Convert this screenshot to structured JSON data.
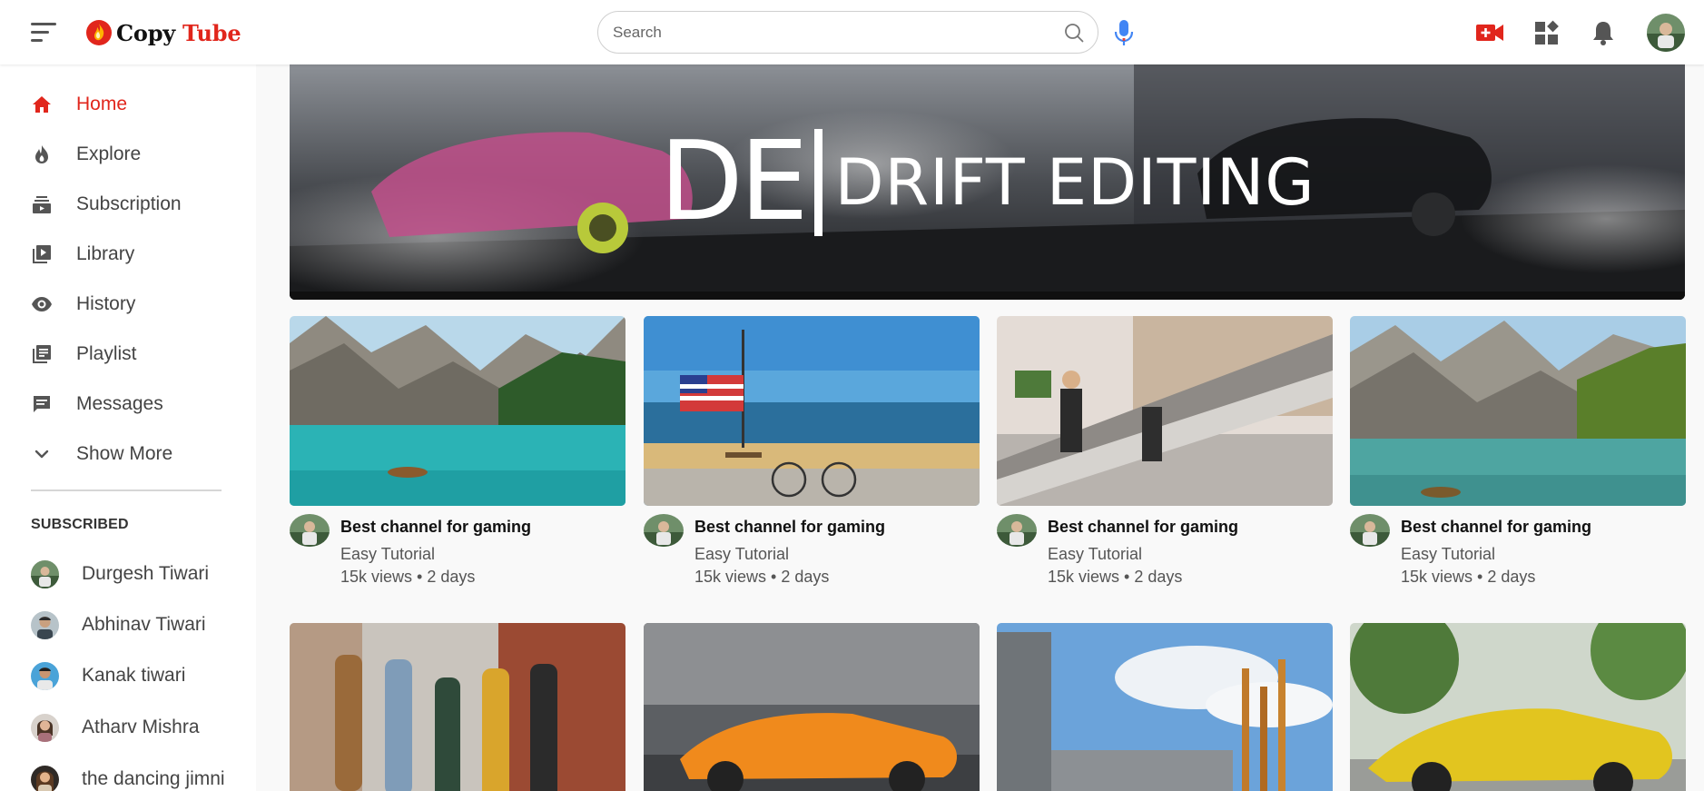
{
  "header": {
    "logo_word1": "Copy",
    "logo_word2": "Tube",
    "search_placeholder": "Search",
    "search_value": ""
  },
  "colors": {
    "accent": "#e1261c",
    "mic": "#4285f4"
  },
  "sidebar": {
    "items": [
      {
        "label": "Home",
        "icon": "home-icon",
        "active": true
      },
      {
        "label": "Explore",
        "icon": "flame-icon",
        "active": false
      },
      {
        "label": "Subscription",
        "icon": "subscriptions-icon",
        "active": false
      },
      {
        "label": "Library",
        "icon": "library-icon",
        "active": false
      },
      {
        "label": "History",
        "icon": "eye-icon",
        "active": false
      },
      {
        "label": "Playlist",
        "icon": "playlist-icon",
        "active": false
      },
      {
        "label": "Messages",
        "icon": "chat-icon",
        "active": false
      },
      {
        "label": "Show More",
        "icon": "chevron-down-icon",
        "active": false
      }
    ],
    "subscribed_heading": "SUBSCRIBED",
    "subscriptions": [
      {
        "name": "Durgesh Tiwari"
      },
      {
        "name": "Abhinav Tiwari"
      },
      {
        "name": "Kanak tiwari"
      },
      {
        "name": "Atharv Mishra"
      },
      {
        "name": "the dancing jimni"
      }
    ]
  },
  "banner": {
    "logo_letters": "DE",
    "title": "DRIFT EDITING"
  },
  "videos": [
    {
      "title": "Best channel for gaming",
      "channel": "Easy Tutorial",
      "meta": "15k views • 2 days",
      "thumb": "lake-mountains"
    },
    {
      "title": "Best channel for gaming",
      "channel": "Easy Tutorial",
      "meta": "15k views • 2 days",
      "thumb": "beach-flag-cyclist"
    },
    {
      "title": "Best channel for gaming",
      "channel": "Easy Tutorial",
      "meta": "15k views • 2 days",
      "thumb": "escalator-mall"
    },
    {
      "title": "Best channel for gaming",
      "channel": "Easy Tutorial",
      "meta": "15k views • 2 days",
      "thumb": "lake-mountains-2"
    },
    {
      "thumb": "friends-walking"
    },
    {
      "thumb": "orange-sports-car"
    },
    {
      "thumb": "campus-building"
    },
    {
      "thumb": "yellow-sports-car"
    }
  ]
}
